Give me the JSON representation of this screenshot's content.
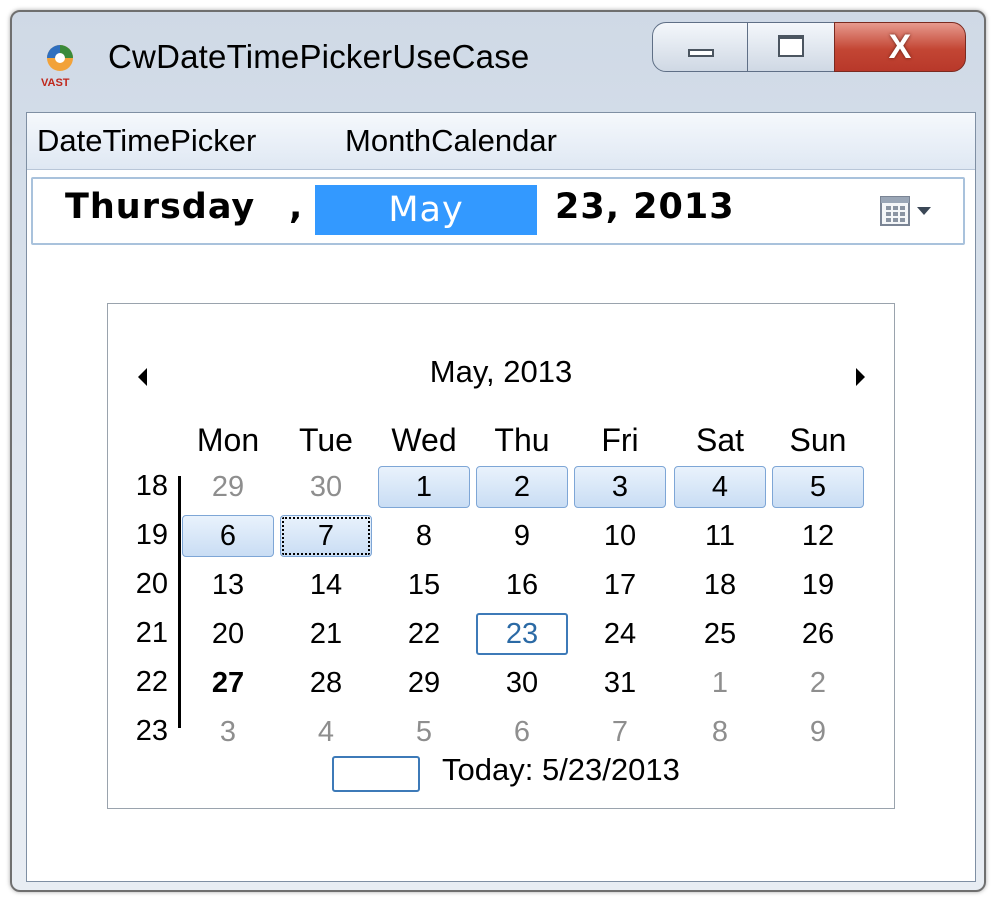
{
  "window": {
    "title": "CwDateTimePickerUseCase",
    "icon": "vast-logo-icon",
    "icon_text": "VAST",
    "buttons": [
      "minimize",
      "maximize",
      "close"
    ],
    "close_glyph": "X"
  },
  "menu": {
    "items": [
      "DateTimePicker",
      "MonthCalendar"
    ]
  },
  "date_picker": {
    "weekday": "Thursday",
    "separator": ",",
    "month": "May",
    "day_year": "23, 2013",
    "dropdown_icon": "calendar-dropdown-icon"
  },
  "calendar": {
    "title": "May, 2013",
    "prev_icon": "prev-month-arrow",
    "next_icon": "next-month-arrow",
    "weekdays": [
      "Mon",
      "Tue",
      "Wed",
      "Thu",
      "Fri",
      "Sat",
      "Sun"
    ],
    "weeks": [
      {
        "number": "18",
        "days": [
          {
            "label": "29",
            "muted": true
          },
          {
            "label": "30",
            "muted": true
          },
          {
            "label": "1",
            "selected": true
          },
          {
            "label": "2",
            "selected": true
          },
          {
            "label": "3",
            "selected": true
          },
          {
            "label": "4",
            "selected": true
          },
          {
            "label": "5",
            "selected": true
          }
        ]
      },
      {
        "number": "19",
        "days": [
          {
            "label": "6",
            "selected": true
          },
          {
            "label": "7",
            "selected": true,
            "focused": true
          },
          {
            "label": "8"
          },
          {
            "label": "9"
          },
          {
            "label": "10"
          },
          {
            "label": "11"
          },
          {
            "label": "12"
          }
        ]
      },
      {
        "number": "20",
        "days": [
          {
            "label": "13"
          },
          {
            "label": "14"
          },
          {
            "label": "15"
          },
          {
            "label": "16"
          },
          {
            "label": "17"
          },
          {
            "label": "18"
          },
          {
            "label": "19"
          }
        ]
      },
      {
        "number": "21",
        "days": [
          {
            "label": "20"
          },
          {
            "label": "21"
          },
          {
            "label": "22"
          },
          {
            "label": "23",
            "today": true
          },
          {
            "label": "24"
          },
          {
            "label": "25"
          },
          {
            "label": "26"
          }
        ]
      },
      {
        "number": "22",
        "days": [
          {
            "label": "27",
            "bold": true
          },
          {
            "label": "28"
          },
          {
            "label": "29"
          },
          {
            "label": "30"
          },
          {
            "label": "31"
          },
          {
            "label": "1",
            "muted": true
          },
          {
            "label": "2",
            "muted": true
          }
        ]
      },
      {
        "number": "23",
        "days": [
          {
            "label": "3",
            "muted": true
          },
          {
            "label": "4",
            "muted": true
          },
          {
            "label": "5",
            "muted": true
          },
          {
            "label": "6",
            "muted": true
          },
          {
            "label": "7",
            "muted": true
          },
          {
            "label": "8",
            "muted": true
          },
          {
            "label": "9",
            "muted": true
          }
        ]
      }
    ],
    "today_label": "Today: 5/23/2013"
  }
}
